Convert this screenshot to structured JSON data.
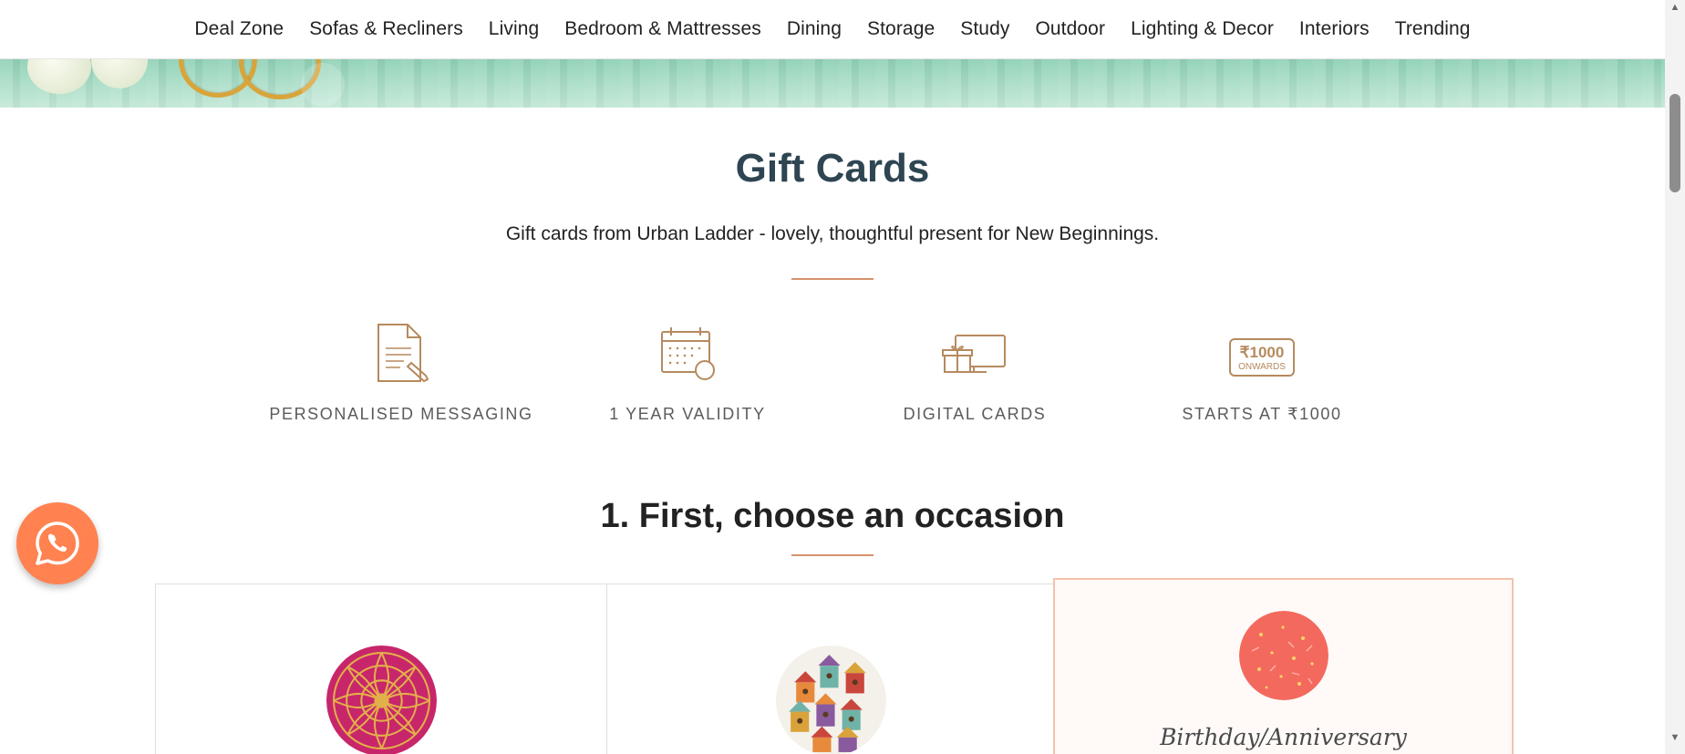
{
  "nav": {
    "items": [
      "Deal Zone",
      "Sofas & Recliners",
      "Living",
      "Bedroom & Mattresses",
      "Dining",
      "Storage",
      "Study",
      "Outdoor",
      "Lighting & Decor",
      "Interiors",
      "Trending"
    ]
  },
  "header": {
    "title": "Gift Cards",
    "subtitle": "Gift cards from Urban Ladder - lovely, thoughtful present for New Beginnings."
  },
  "features": [
    {
      "label": "PERSONALISED MESSAGING",
      "icon": "document-pen-icon"
    },
    {
      "label": "1 YEAR VALIDITY",
      "icon": "calendar-clock-icon"
    },
    {
      "label": "DIGITAL CARDS",
      "icon": "monitor-gift-icon"
    },
    {
      "label": "STARTS AT ₹1000",
      "icon": "price-badge-icon",
      "badge_amount": "₹1000",
      "badge_text": "ONWARDS"
    }
  ],
  "occasion": {
    "heading": "1. First, choose an occasion",
    "cards": [
      {
        "label": "",
        "selected": false
      },
      {
        "label": "",
        "selected": false
      },
      {
        "label": "Birthday/Anniversary",
        "selected": true
      }
    ]
  },
  "colors": {
    "accent": "#d6926f",
    "title": "#2e4552",
    "icon": "#b68a5e",
    "whatsapp": "#ff8250"
  }
}
